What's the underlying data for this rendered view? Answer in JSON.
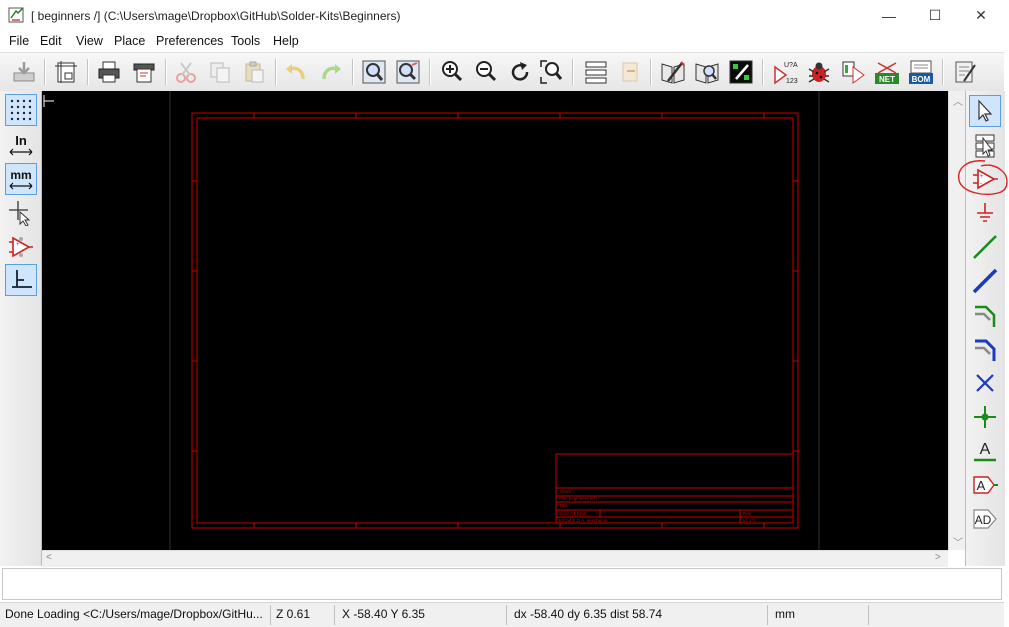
{
  "window": {
    "title": "[ beginners /] (C:\\Users\\mage\\Dropbox\\GitHub\\Solder-Kits\\Beginners)",
    "minimize_glyph": "—",
    "maximize_glyph": "☐",
    "close_glyph": "✕"
  },
  "menubar": {
    "items": [
      "File",
      "Edit",
      "View",
      "Place",
      "Preferences",
      "Tools",
      "Help"
    ]
  },
  "toolbar": {
    "icons": [
      "save-icon",
      "page-settings-icon",
      "print-icon",
      "plot-icon",
      "cut-icon",
      "copy-icon",
      "paste-icon",
      "undo-icon",
      "redo-icon",
      "find-icon",
      "find-replace-icon",
      "zoom-in-icon",
      "zoom-out-icon",
      "redraw-icon",
      "zoom-fit-icon",
      "hierarchy-navigator-icon",
      "library-editor-icon",
      "library-browser-icon",
      "pcb-new-icon",
      "annotate-icon",
      "erc-icon",
      "cvpcb-icon",
      "netlist-icon",
      "bom-icon",
      "pcbnew-icon"
    ],
    "annotate_label": "U?A",
    "annotate_sub": "123",
    "netlist_label": "NET",
    "bom_label": "BOM"
  },
  "left_toolbar": {
    "units_in_label": "In",
    "units_mm_label": "mm"
  },
  "sheet": {
    "titleblock_lines": [
      "Sheet: /",
      "File: beginners.sch",
      "Title:",
      "Size: A4    Date:",
      "KiCad E.D.A.  eeschema",
      "Rev:",
      "Id: 1/1"
    ]
  },
  "status": {
    "message": "Done Loading <C:/Users/mage/Dropbox/GitHu...",
    "zoom": "Z 0.61",
    "coords": "X -58.40  Y 6.35",
    "delta": "dx -58.40  dy 6.35  dist 58.74",
    "units": "mm"
  },
  "colors": {
    "canvas_bg": "#000000",
    "sheet_border": "#c80000",
    "annotation_circle": "#e02020",
    "selection_highlight": "#cfe5fb"
  }
}
